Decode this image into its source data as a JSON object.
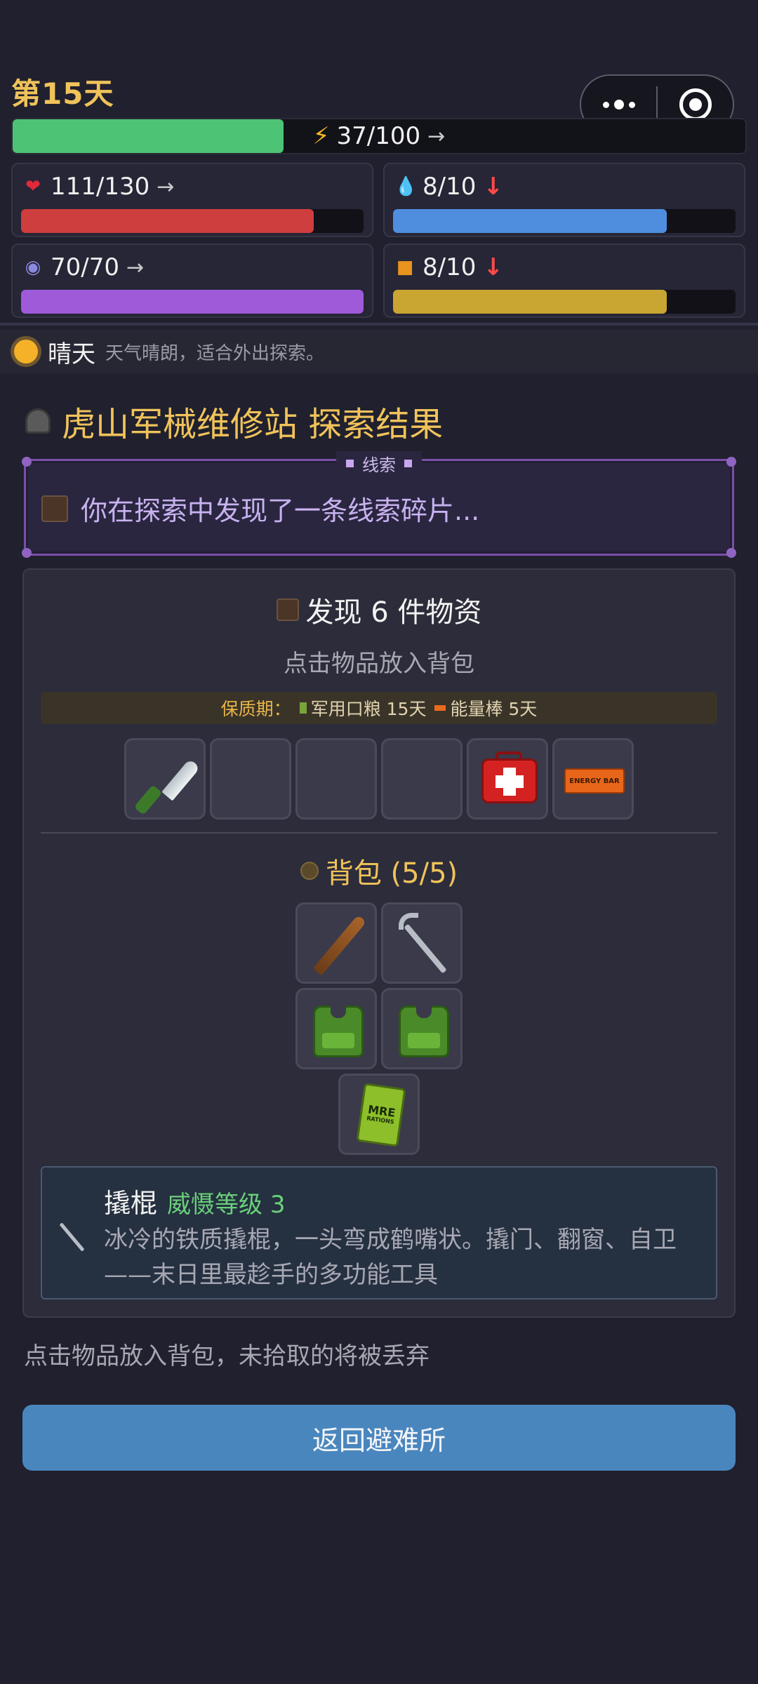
{
  "header": {
    "day": "第15天",
    "energy": {
      "label": "37/100",
      "arrow": "→",
      "fraction": 0.37,
      "color": "#4dc475"
    }
  },
  "capsule": {
    "more_icon": "more-dots-icon",
    "close_icon": "target-icon"
  },
  "stats": [
    {
      "icon": "heart-icon",
      "value": "111/130",
      "trend": "→",
      "fraction": 0.854,
      "color": "#cf3e3e"
    },
    {
      "icon": "water-drop-icon",
      "value": "8/10",
      "trend": "↓",
      "fraction": 0.8,
      "color": "#4f8ede"
    },
    {
      "icon": "brain-icon",
      "value": "70/70",
      "trend": "→",
      "fraction": 1.0,
      "color": "#9e5ad8"
    },
    {
      "icon": "food-icon",
      "value": "8/10",
      "trend": "↓",
      "fraction": 0.8,
      "color": "#c9a532"
    }
  ],
  "weather": {
    "icon": "sun-icon",
    "name": "晴天",
    "desc": "天气晴朗，适合外出探索。"
  },
  "location_title": "虎山军械维修站 探索结果",
  "clue": {
    "tag": "线索",
    "text": "你在探索中发现了一条线索碎片..."
  },
  "found": {
    "title": "发现 6 件物资",
    "hint": "点击物品放入背包",
    "shelf_label": "保质期：",
    "shelf_items": [
      "军用口粮 15天",
      "能量棒 5天"
    ],
    "slots": [
      "knife-icon",
      "",
      "",
      "",
      "medkit-icon",
      "energy-bar-icon"
    ],
    "energy_bar_text": "ENERGY BAR"
  },
  "bag": {
    "title": "背包 (5/5)",
    "items": [
      "baseball-bat-icon",
      "crowbar-icon",
      "tactical-vest-icon",
      "tactical-vest-icon",
      "mre-icon"
    ],
    "mre_text": "MRE",
    "mre_sub": "RATIONS"
  },
  "detail": {
    "name": "撬棍",
    "level": "威慑等级 3",
    "desc": "冰冷的铁质撬棍，一头弯成鹤嘴状。撬门、翻窗、自卫——末日里最趁手的多功能工具"
  },
  "footer_note": "点击物品放入背包，未拾取的将被丢弃",
  "return_button": "返回避难所"
}
